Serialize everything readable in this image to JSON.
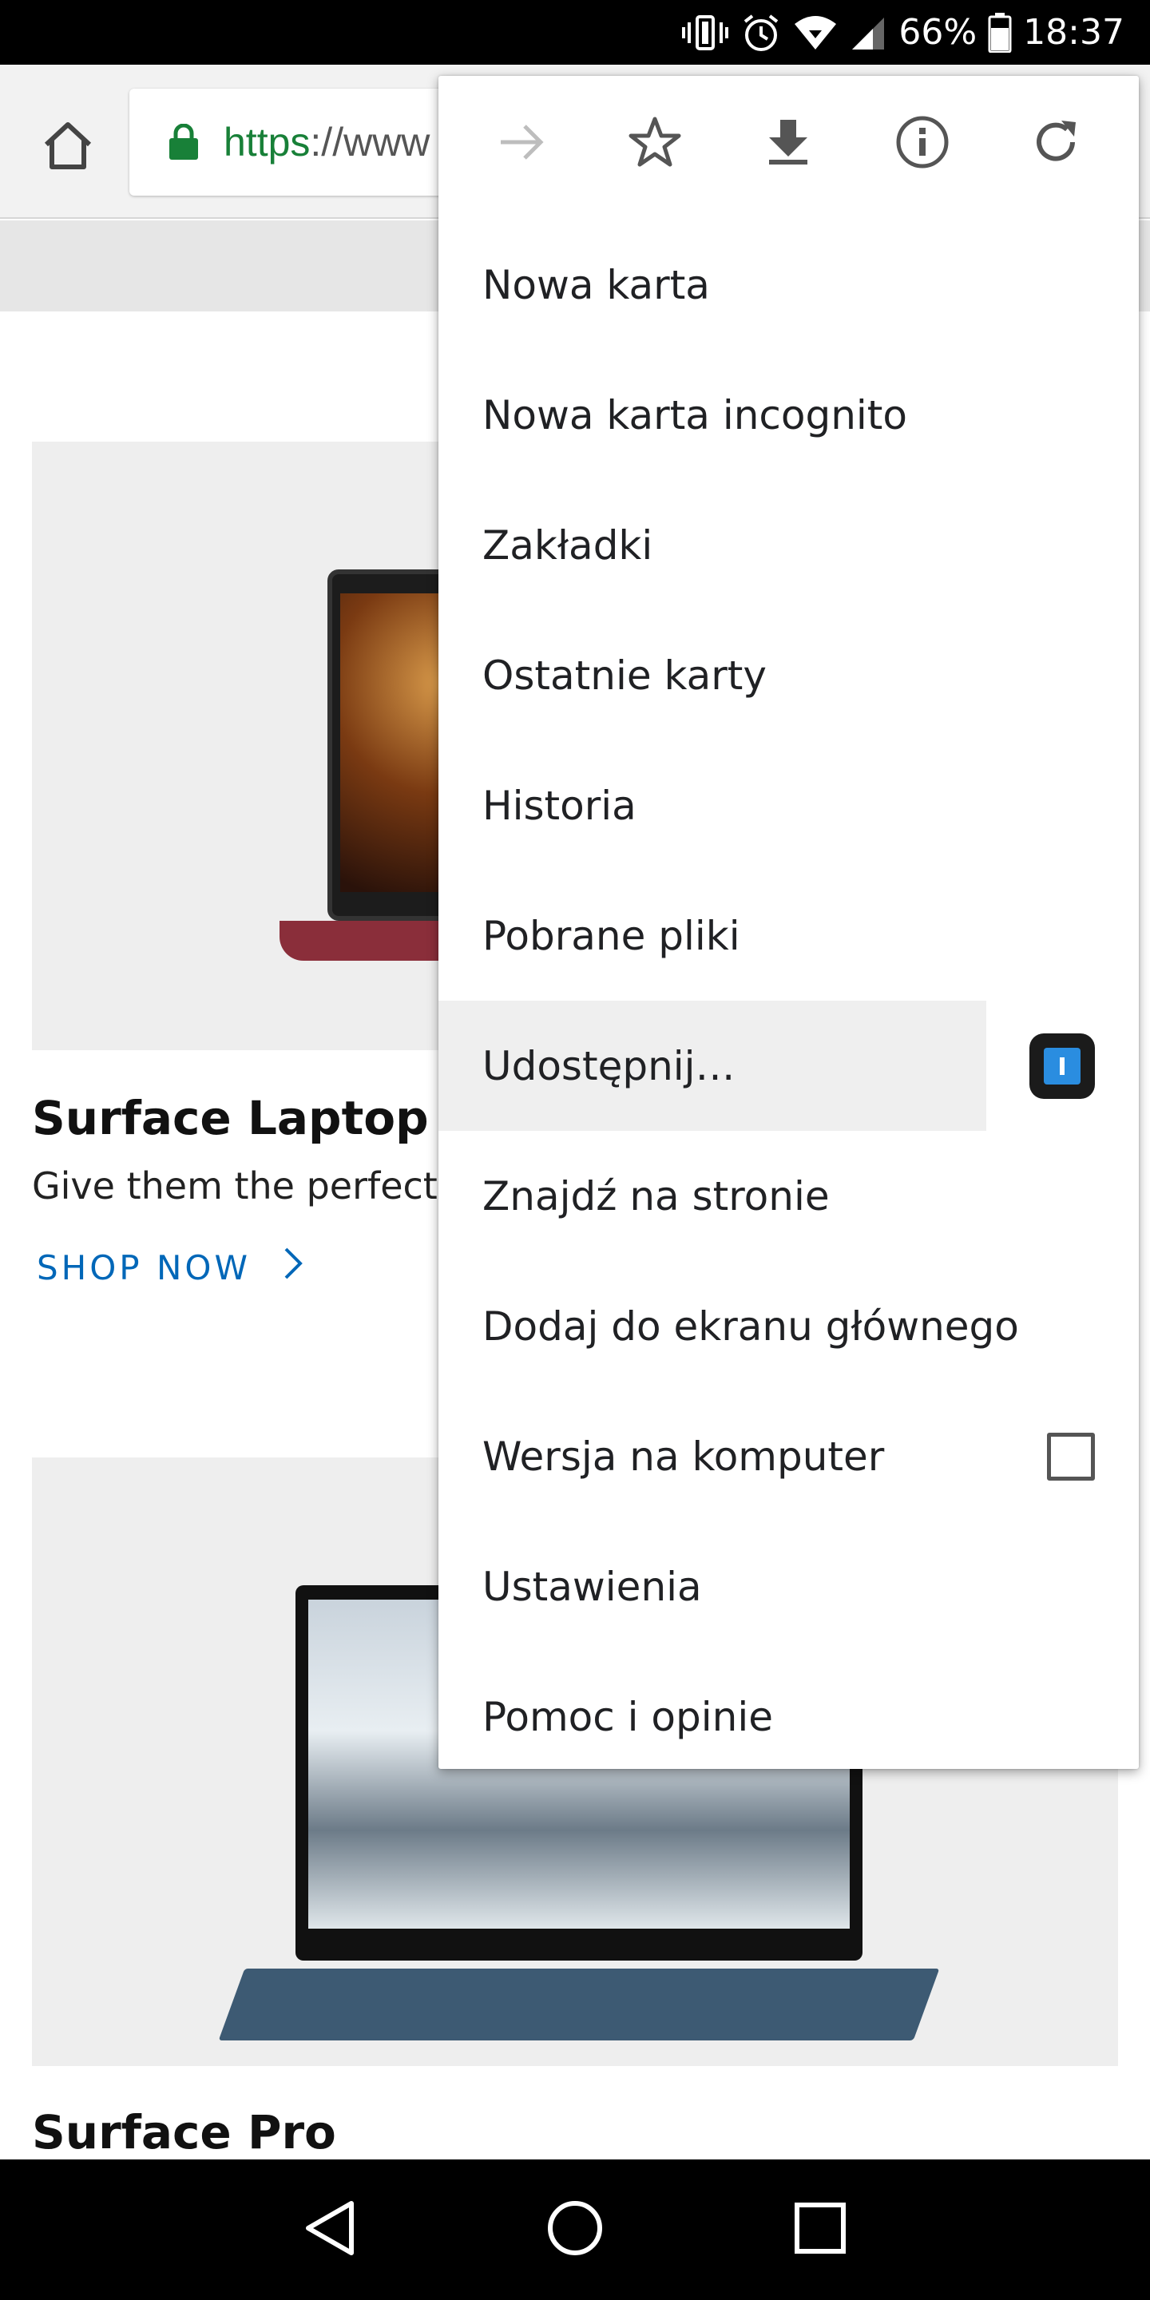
{
  "status_bar": {
    "battery": "66%",
    "time": "18:37",
    "icons": [
      "vibrate-icon",
      "alarm-icon",
      "wifi-icon",
      "signal-icon",
      "battery-icon"
    ]
  },
  "toolbar": {
    "home_icon": "home-icon",
    "lock_icon": "lock-icon",
    "url_scheme": "https",
    "url_rest": "://www"
  },
  "page": {
    "products": [
      {
        "title": "Surface Laptop",
        "desc": "Give them the perfect l",
        "cta": "SHOP NOW"
      },
      {
        "title": "Surface Pro"
      }
    ]
  },
  "menu": {
    "icons": [
      "forward-icon",
      "bookmark-star-icon",
      "download-icon",
      "info-icon",
      "reload-icon"
    ],
    "items": [
      {
        "label": "Nowa karta"
      },
      {
        "label": "Nowa karta incognito"
      },
      {
        "label": "Zakładki"
      },
      {
        "label": "Ostatnie karty"
      },
      {
        "label": "Historia"
      },
      {
        "label": "Pobrane pliki"
      },
      {
        "label": "Udostępnij…"
      },
      {
        "label": "Znajdź na stronie"
      },
      {
        "label": "Dodaj do ekranu głównego"
      },
      {
        "label": "Wersja na komputer",
        "checked": false
      },
      {
        "label": "Ustawienia"
      },
      {
        "label": "Pomoc i opinie"
      }
    ]
  },
  "navbar": {
    "icons": [
      "back-icon",
      "home-circle-icon",
      "recents-icon"
    ]
  },
  "colors": {
    "url_green": "#188038",
    "link_blue": "#0067b8",
    "menu_highlight": "#efefef"
  }
}
